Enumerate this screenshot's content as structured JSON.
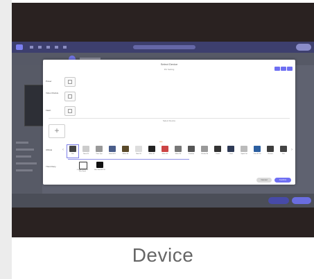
{
  "caption": "Device",
  "modal": {
    "title": "Select Device",
    "pin_section": "Pin Setting",
    "rows": [
      {
        "label": "Power"
      },
      {
        "label": "Video Module"
      },
      {
        "label": "Flash"
      }
    ],
    "device_section": "Select Device",
    "add_symbol": "+",
    "wire_label": "wire",
    "category_labels": {
      "official": "Official",
      "third_party": "Third Party"
    },
    "devices": [
      "Kite",
      "Nano 33",
      "Timer Tips",
      "Node MCU",
      "Melon S3",
      "Mele S3",
      "Melon S1",
      "Melon S3",
      "Melon S3",
      "Freedom",
      "Chicken Bit",
      "Comet",
      "Cloud",
      "Spend Lid",
      "Cone RT S3",
      "Chimera",
      "Fan"
    ],
    "third_party_devices": [
      "Custom Device Kit Elec Board",
      "Elec Fim ESP S3"
    ],
    "buttons": {
      "cancel": "Cancel",
      "confirm": "Confirm"
    }
  },
  "colors": {
    "accent": "#6f6ff3",
    "dark_bg": "#2a2221",
    "caption": "#666666"
  }
}
